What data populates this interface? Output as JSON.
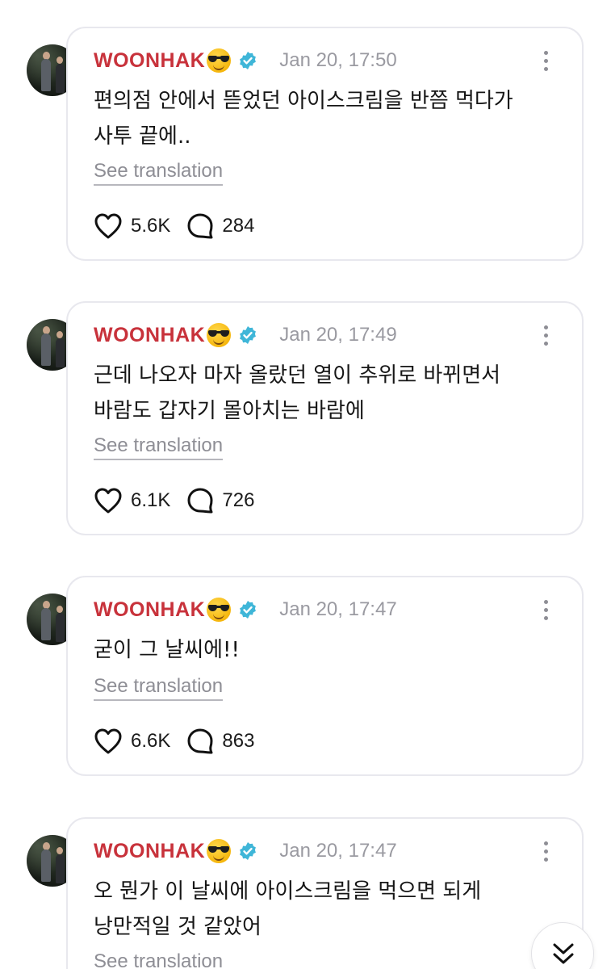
{
  "posts": [
    {
      "username": "WOONHAK",
      "timestamp": "Jan 20, 17:50",
      "text": "편의점 안에서 뜯었던 아이스크림을 반쯤 먹다가\n사투 끝에..",
      "translate_label": "See translation",
      "likes": "5.6K",
      "replies": "284"
    },
    {
      "username": "WOONHAK",
      "timestamp": "Jan 20, 17:49",
      "text": "근데 나오자 마자 올랐던 열이 추위로 바뀌면서\n바람도 갑자기 몰아치는 바람에",
      "translate_label": "See translation",
      "likes": "6.1K",
      "replies": "726"
    },
    {
      "username": "WOONHAK",
      "timestamp": "Jan 20, 17:47",
      "text": "굳이 그 날씨에!!",
      "translate_label": "See translation",
      "likes": "6.6K",
      "replies": "863"
    },
    {
      "username": "WOONHAK",
      "timestamp": "Jan 20, 17:47",
      "text": "오 뭔가 이 날씨에 아이스크림을 먹으면 되게\n낭만적일 것 같았어",
      "translate_label": "See translation"
    }
  ],
  "icons": {
    "verified": "verified-badge-icon",
    "emoji": "sunglasses-emoji-icon",
    "more": "more-vertical-icon",
    "like": "heart-icon",
    "reply": "reply-bubble-icon",
    "scroll": "double-chevron-down-icon"
  },
  "colors": {
    "username": "#c8323b",
    "verified": "#3fb6d8",
    "timestamp": "#9a9aa1",
    "card_border": "#e8e8ee"
  }
}
